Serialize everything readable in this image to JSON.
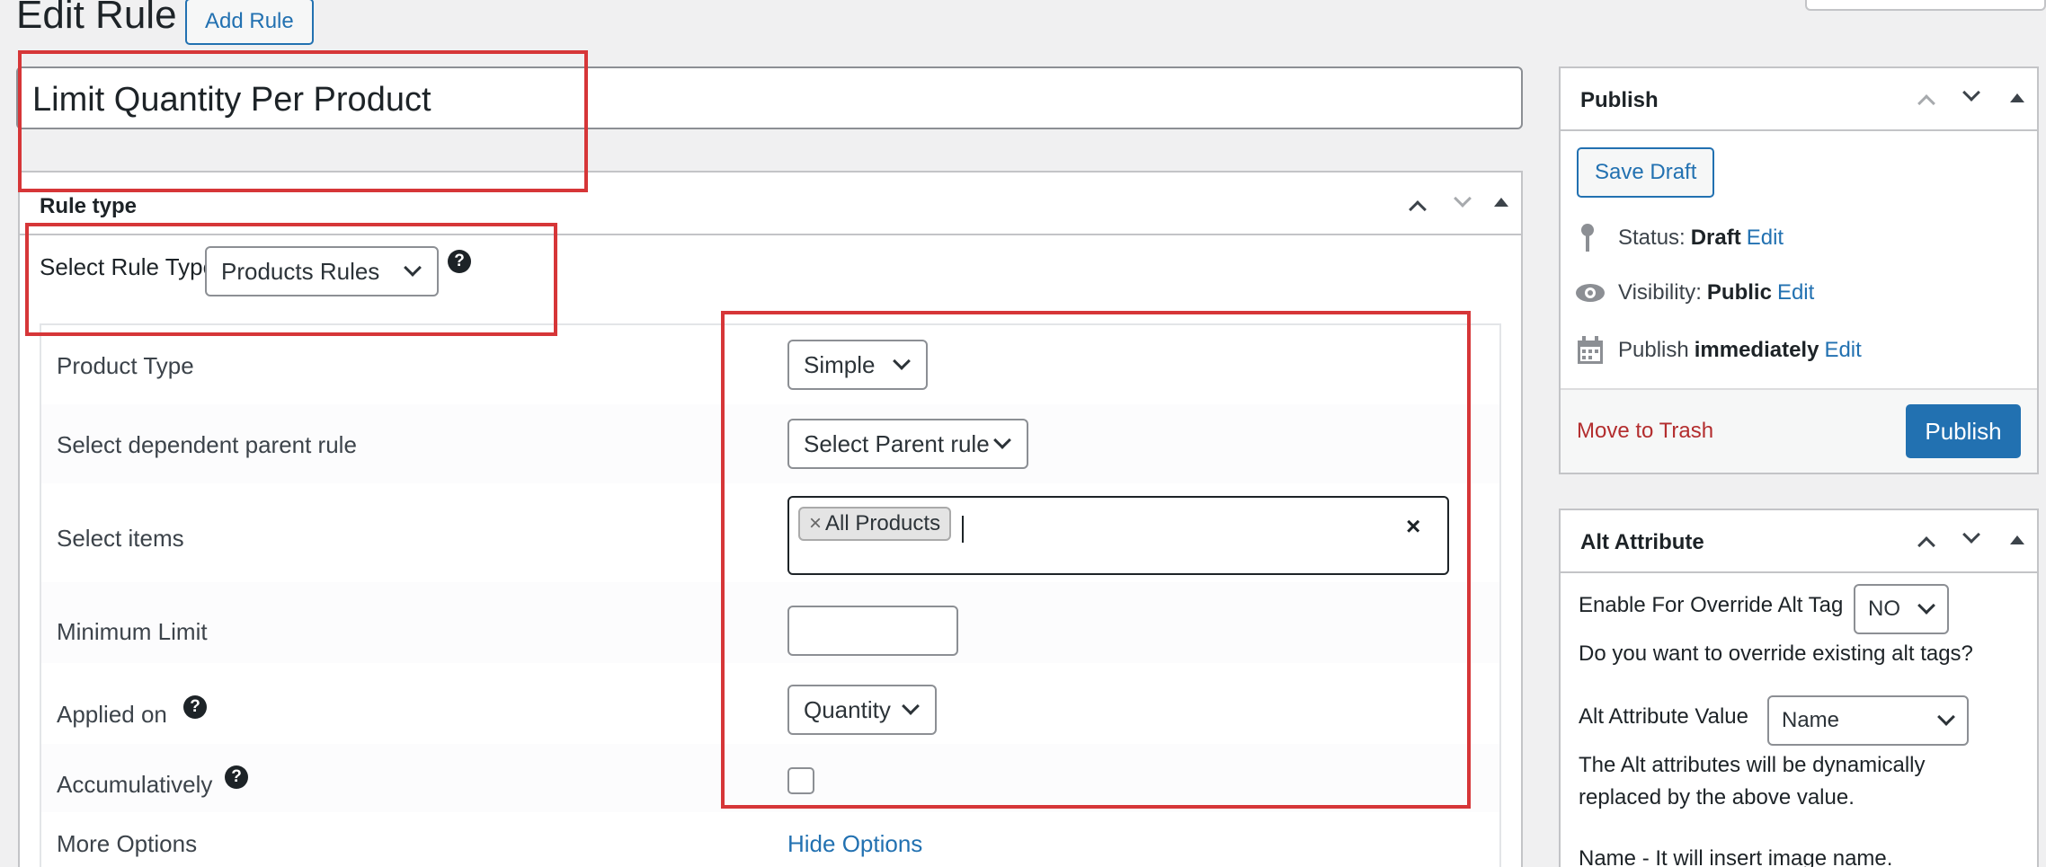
{
  "page": {
    "heading": "Edit Rule",
    "add_button": "Add Rule",
    "title_value": "Limit Quantity Per Product"
  },
  "rule_type_box": {
    "title": "Rule type",
    "select_label": "Select Rule Type",
    "select_value": "Products Rules"
  },
  "fields": {
    "product_type_label": "Product Type",
    "product_type_value": "Simple",
    "parent_rule_label": "Select dependent parent rule",
    "parent_rule_value": "Select Parent rule",
    "select_items_label": "Select items",
    "selected_token": "All Products",
    "token_remove": "×",
    "clear_all": "×",
    "minimum_limit_label": "Minimum Limit",
    "minimum_limit_value": "",
    "applied_on_label": "Applied on",
    "applied_on_value": "Quantity",
    "accumulatively_label": "Accumulatively",
    "more_options_label": "More Options",
    "hide_options_link": "Hide Options"
  },
  "publish_box": {
    "title": "Publish",
    "save_draft": "Save Draft",
    "status_label": "Status:",
    "status_value": "Draft",
    "visibility_label": "Visibility:",
    "visibility_value": "Public",
    "publish_label": "Publish",
    "publish_value": "immediately",
    "edit_link": "Edit",
    "move_to_trash": "Move to Trash",
    "publish_button": "Publish"
  },
  "alt_box": {
    "title": "Alt Attribute",
    "enable_label": "Enable For Override Alt Tag",
    "enable_value": "NO",
    "override_question": "Do you want to override existing alt tags?",
    "value_label": "Alt Attribute Value",
    "value_selected": "Name",
    "dynamic_note_line1": "The Alt attributes will be dynamically",
    "dynamic_note_line2": "replaced by the above value.",
    "name_note": "Name - It will insert image name."
  },
  "colors": {
    "accent": "#2271b1",
    "highlight_red": "#d63638",
    "trash_red": "#b32d2e"
  }
}
